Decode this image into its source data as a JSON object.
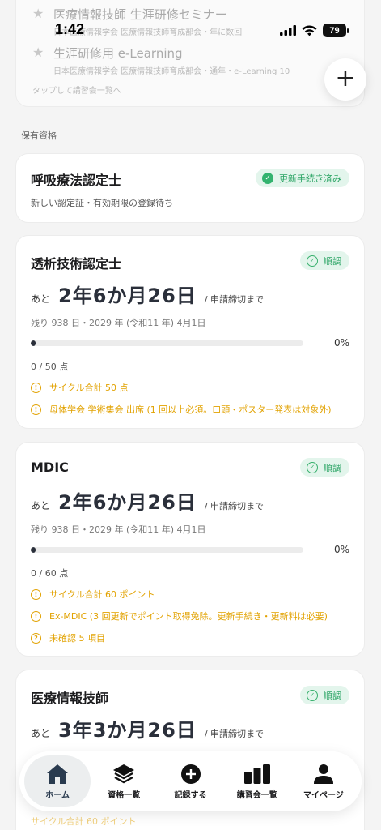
{
  "status_bar": {
    "time": "1:42",
    "battery": "79"
  },
  "seminars": [
    {
      "title": "医療情報技師 生涯研修セミナー",
      "subtitle": "日本医療情報学会 医療情報技師育成部会・年に数回"
    },
    {
      "title": "生涯研修用 e-Learning",
      "subtitle": "日本医療情報学会 医療情報技師育成部会・通年・e-Learning 10"
    }
  ],
  "seminar_link": "タップして講習会一覧へ",
  "fab_label": "+",
  "section_label": "保有資格",
  "cards": [
    {
      "title": "呼吸療法認定士",
      "badge": "更新手続き済み",
      "note": "新しい認定証・有効期限の登録待ち"
    },
    {
      "title": "透析技術認定士",
      "badge": "順調",
      "ato": "あと",
      "deadline": "2年6か月26日",
      "until": "/ 申請締切まで",
      "remain": "残り 938 日・2029 年 (令和11 年) 4月1日",
      "progress": 0,
      "percent": "0%",
      "points": "0 / 50 点",
      "warnings": [
        "サイクル合計 50 点",
        "母体学会 学術集会 出席 (1 回以上必須。口頭・ポスター発表は対象外)"
      ]
    },
    {
      "title": "MDIC",
      "badge": "順調",
      "ato": "あと",
      "deadline": "2年6か月26日",
      "until": "/ 申請締切まで",
      "remain": "残り 938 日・2029 年 (令和11 年) 4月1日",
      "progress": 0,
      "percent": "0%",
      "points": "0 / 60 点",
      "warnings": [
        "サイクル合計 60 ポイント",
        "Ex-MDIC (3 回更新でポイント取得免除。更新手続き・更新料は必要)",
        "未確認 5 項目"
      ]
    },
    {
      "title": "医療情報技師",
      "badge": "順調",
      "ato": "あと",
      "deadline": "3年3か月26日",
      "until": "/ 申請締切まで",
      "behind_text": "サイクル合計 60 ポイント"
    }
  ],
  "tabs": [
    {
      "label": "ホーム",
      "icon": "home-icon"
    },
    {
      "label": "資格一覧",
      "icon": "layers-icon"
    },
    {
      "label": "記録する",
      "icon": "plus-circle-icon"
    },
    {
      "label": "講習会一覧",
      "icon": "bar-chart-icon"
    },
    {
      "label": "マイページ",
      "icon": "person-icon"
    }
  ],
  "colors": {
    "accent_green": "#2aa464",
    "warning": "#e2a200",
    "dark": "#2a2f3a"
  }
}
